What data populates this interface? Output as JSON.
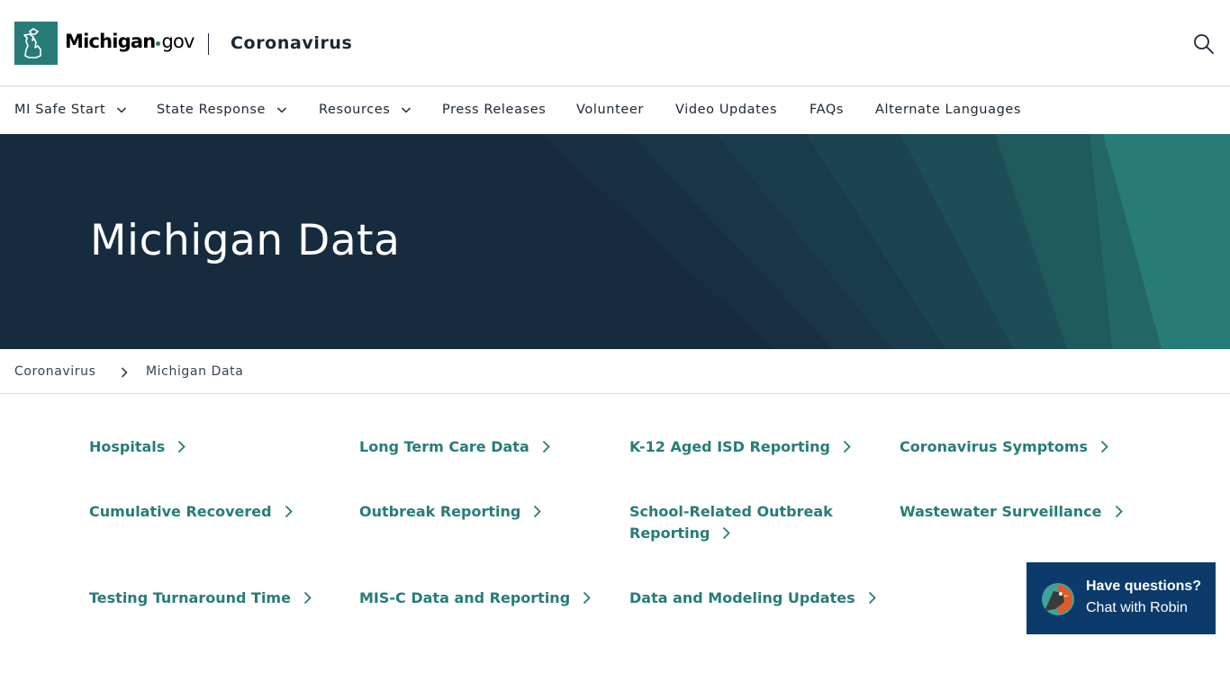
{
  "header": {
    "logo_brand": "Michigan",
    "logo_suffix": "gov",
    "site_title": "Coronavirus"
  },
  "nav": {
    "items": [
      {
        "label": "MI Safe Start",
        "has_dropdown": true
      },
      {
        "label": "State Response",
        "has_dropdown": true
      },
      {
        "label": "Resources",
        "has_dropdown": true
      },
      {
        "label": "Press Releases",
        "has_dropdown": false
      },
      {
        "label": "Volunteer",
        "has_dropdown": false
      },
      {
        "label": "Video Updates",
        "has_dropdown": false
      },
      {
        "label": "FAQs",
        "has_dropdown": false
      },
      {
        "label": "Alternate Languages",
        "has_dropdown": false
      }
    ]
  },
  "hero": {
    "title": "Michigan Data"
  },
  "breadcrumb": {
    "items": [
      "Coronavirus",
      "Michigan Data"
    ]
  },
  "links": {
    "items": [
      {
        "line1": "Hospitals",
        "line2": ""
      },
      {
        "line1": "Long Term Care Data",
        "line2": ""
      },
      {
        "line1": "K-12 Aged ISD Reporting",
        "line2": ""
      },
      {
        "line1": "Coronavirus Symptoms",
        "line2": ""
      },
      {
        "line1": "Cumulative Recovered",
        "line2": ""
      },
      {
        "line1": "Outbreak Reporting",
        "line2": ""
      },
      {
        "line1": "School-Related Outbreak",
        "line2": "Reporting"
      },
      {
        "line1": "Wastewater Surveillance",
        "line2": ""
      },
      {
        "line1": "Testing Turnaround Time",
        "line2": ""
      },
      {
        "line1": "MIS-C Data and Reporting",
        "line2": ""
      },
      {
        "line1": "Data and Modeling Updates",
        "line2": ""
      }
    ]
  },
  "chat": {
    "line1": "Have questions?",
    "line2": "Chat with Robin"
  },
  "colors": {
    "brand_teal": "#277c78",
    "hero_navy": "#172b3f",
    "chat_blue": "#0b3a6b"
  },
  "icons": {
    "logo": "michigan-mitten-icon",
    "search": "search-icon",
    "nav_dropdown": "chevron-down-icon",
    "breadcrumb_separator": "chevron-right-icon",
    "link_arrow": "chevron-right-icon",
    "chat": "robin-bird-icon"
  }
}
